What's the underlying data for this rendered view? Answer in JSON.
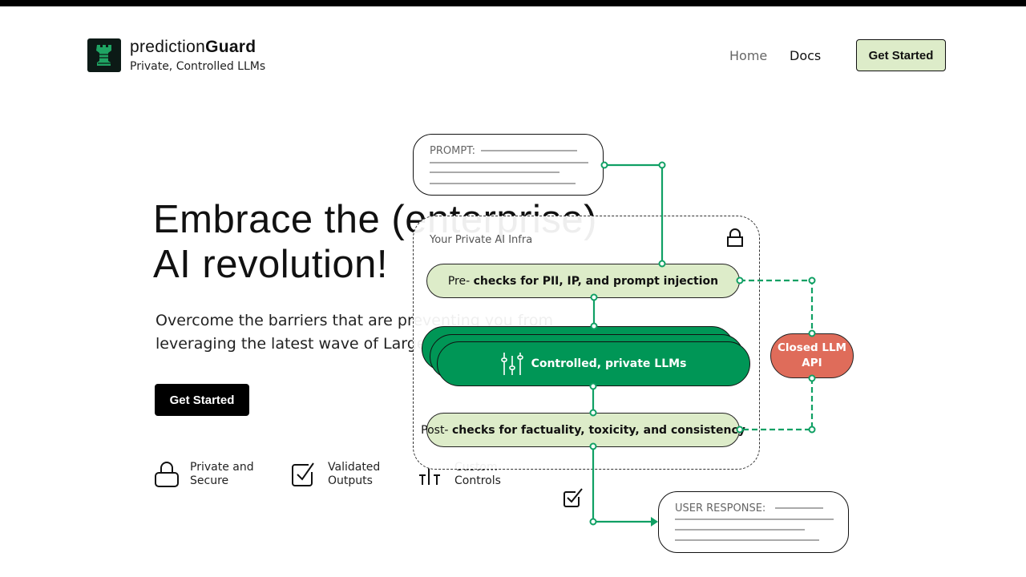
{
  "header": {
    "brand_prefix": "prediction",
    "brand_suffix": "Guard",
    "tagline": "Private, Controlled LLMs",
    "nav": [
      {
        "label": "Home"
      },
      {
        "label": "Docs"
      }
    ],
    "cta": "Get Started"
  },
  "hero": {
    "title_line1": "Embrace the (enterprise)",
    "title_line2": "AI revolution!",
    "subtitle_line1": "Overcome the barriers that are preventing you from",
    "subtitle_line2": "leveraging the latest wave of Large Language Models",
    "cta": "Get Started",
    "features": [
      {
        "icon": "lock-icon",
        "label": "Private and Secure"
      },
      {
        "icon": "checkbox-icon",
        "label": "Validated Outputs"
      },
      {
        "icon": "sliders-icon",
        "label": "Custom Controls"
      }
    ]
  },
  "diagram": {
    "prompt_label": "PROMPT:",
    "infra_title": "Your Private AI Infra",
    "pre_prefix": "Pre-",
    "pre_text": "checks for PII, IP, and prompt injection",
    "llm_label": "Controlled, private LLMs",
    "post_prefix": "Post-",
    "post_text": "checks for factuality, toxicity, and consistency",
    "closed_line1": "Closed LLM",
    "closed_line2": "API",
    "response_label": "USER RESPONSE:"
  },
  "colors": {
    "accent_green": "#009656",
    "light_green": "#ddecc9",
    "closed_api": "#df6c5a"
  }
}
